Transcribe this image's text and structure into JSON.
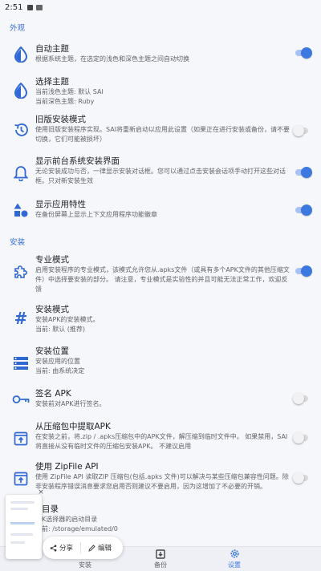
{
  "status_bar": {
    "time": "2:51"
  },
  "sections": {
    "appearance": "外观",
    "install": "安装"
  },
  "settings": {
    "auto_theme": {
      "title": "自动主题",
      "desc": "根据系统主题，在选定的浅色和深色主题之间自动切换",
      "toggle": "on"
    },
    "select_theme": {
      "title": "选择主题",
      "desc1": "当前浅色主题: 默认 SAI",
      "desc2": "当前深色主题: Ruby"
    },
    "legacy_install": {
      "title": "旧版安装模式",
      "desc": "使用旧版安装程序实现。SAI将重新启动以应用此设置（如果正在进行安装或备份，请不要切换，它们可能被损坏）",
      "toggle": "off"
    },
    "foreground_install": {
      "title": "显示前台系统安装界面",
      "desc": "无论安装成功与否，一律显示安装对话框。您可以通过点击安装会话项手动打开这些对话框。只对新安装生效",
      "toggle": "on"
    },
    "app_features": {
      "title": "显示应用特性",
      "desc": "在备份屏幕上显示上下文应用程序功能徽章",
      "toggle": "on"
    },
    "pro_mode": {
      "title": "专业模式",
      "desc": "启用安装程序的专业模式，该模式允许您从.apks文件（或具有多个APK文件的其他压缩文件）中选择要安装的部分。 请注意，专业模式是实验性的并且可能无法正常工作，欢迎反馈",
      "toggle": "on"
    },
    "install_mode": {
      "title": "安装模式",
      "desc1": "安装APK的安装模式。",
      "desc2": "当前: 默认 (推荐)"
    },
    "install_location": {
      "title": "安装位置",
      "desc1": "安装应用的位置",
      "desc2": "当前: 由系统决定"
    },
    "signature": {
      "title": "签名 APK",
      "desc": "安装前对APK进行签名。",
      "toggle": "off"
    },
    "extract_zip": {
      "title": "从压缩包中提取APK",
      "desc": "在安装之前，将.zip / .apks压缩包中的APK文件，解压缩到临时文件中。 如果禁用，SAI将直接从没有临时文件的压缩包安装APK。 不建议启用",
      "toggle": "off"
    },
    "zipfile_api": {
      "title": "使用 ZipFile API",
      "desc": "使用 ZipFile API 读取ZIP 压缩包(包括.apks 文件)可以解决与某些压缩包兼容性问题。除非安装程序错误消息要求您启用否则建议不要启用，因为这增加了不必要的开销。",
      "toggle": "off"
    },
    "directory": {
      "title": "目录",
      "desc1": "K选择器的启动目录",
      "desc2": "前: /storage/emulated/0"
    }
  },
  "bottom_nav": {
    "install": "安装",
    "backup": "备份",
    "settings": "设置"
  },
  "share_popup": {
    "share": "分享",
    "edit": "编辑",
    "close": "×"
  },
  "colors": {
    "accent": "#3c78e0",
    "section": "#3a6fd8"
  }
}
